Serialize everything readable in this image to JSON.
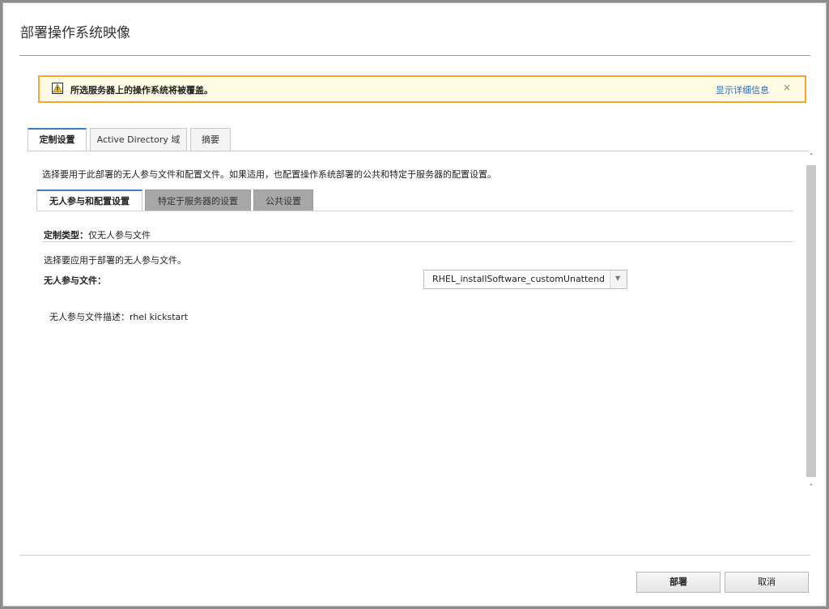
{
  "dialog": {
    "title": "部署操作系统映像"
  },
  "warning": {
    "icon": "warning-icon",
    "message": "所选服务器上的操作系统将被覆盖。",
    "details_link": "显示详细信息",
    "close_label": "×"
  },
  "tabs": [
    {
      "label": "定制设置",
      "active": true
    },
    {
      "label": "Active Directory 域",
      "active": false
    },
    {
      "label": "摘要",
      "active": false
    }
  ],
  "panel": {
    "intro": "选择要用于此部署的无人参与文件和配置文件。如果适用，也配置操作系统部署的公共和特定于服务器的配置设置。",
    "subtabs": [
      {
        "label": "无人参与和配置设置",
        "active": true
      },
      {
        "label": "特定于服务器的设置",
        "active": false
      },
      {
        "label": "公共设置",
        "active": false
      }
    ],
    "customization_type_label": "定制类型：",
    "customization_type_value": "仅无人参与文件",
    "select_help": "选择要应用于部署的无人参与文件。",
    "unattend_file_label": "无人参与文件：",
    "unattend_file_value": "RHEL_installSoftware_customUnattend",
    "description_label": "无人参与文件描述：",
    "description_value": "rhel kickstart"
  },
  "scrollbar": {
    "up_arrow": "˄",
    "down_arrow": "˅"
  },
  "footer": {
    "deploy_label": "部署",
    "cancel_label": "取消"
  }
}
